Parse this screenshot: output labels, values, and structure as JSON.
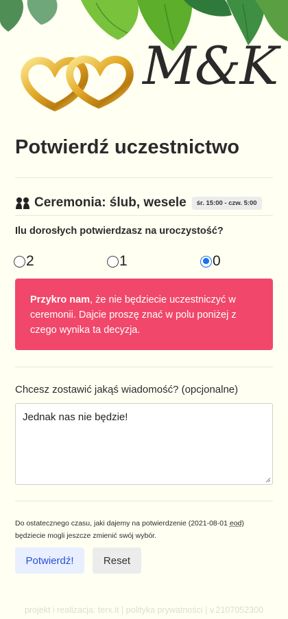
{
  "header": {
    "monogram": "M&K"
  },
  "page": {
    "title": "Potwierdź uczestnictwo"
  },
  "event": {
    "icon": "couple-icon",
    "title": "Ceremonia: ślub, wesele",
    "time_badge": "śr. 15:00 - czw. 5:00"
  },
  "attendance": {
    "question": "Ilu dorosłych potwierdzasz na uroczystość?",
    "options": [
      "2",
      "1",
      "0"
    ],
    "selected": "0"
  },
  "alert": {
    "lead": "Przykro nam",
    "text": ", że nie będziecie uczestniczyć w ceremonii. Dajcie proszę znać w polu poniżej z czego wynika ta decyzja.",
    "color": "#f1476a"
  },
  "message": {
    "label": "Chcesz zostawić jakąś wiadomość? (opcjonalne)",
    "value": "Jednak nas nie będzie!"
  },
  "deadline": {
    "text_before": "Do ostatecznego czasu, jaki dajemy na potwierdzenie (2021-08-01 ",
    "abbr": "eod",
    "text_after": ") będziecie mogli jeszcze zmienić swój wybór."
  },
  "actions": {
    "confirm_label": "Potwierdź!",
    "reset_label": "Reset"
  },
  "footer": {
    "text": "projekt i realizacja: terx.it | polityka prywatności | v.2107052300"
  }
}
